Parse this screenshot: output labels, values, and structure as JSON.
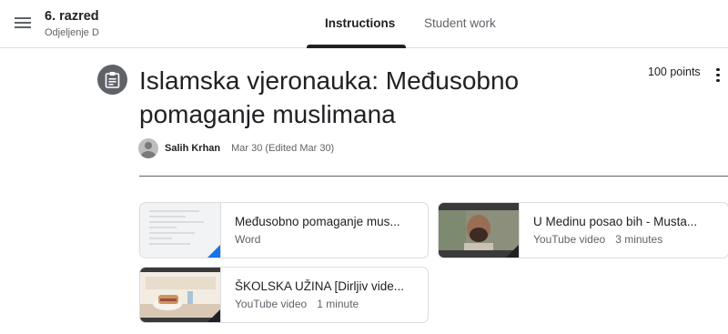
{
  "header": {
    "class_name": "6. razred",
    "class_section": "Odjeljenje D",
    "tabs": [
      {
        "label": "Instructions",
        "active": true
      },
      {
        "label": "Student work",
        "active": false
      }
    ]
  },
  "assignment": {
    "title": "Islamska vjeronauka: Međusobno pomaganje muslimana",
    "points": "100 points",
    "author": "Salih Krhan",
    "date": "Mar 30 (Edited Mar 30)",
    "icon": "assignment-icon"
  },
  "attachments": [
    {
      "title": "Međusobno pomaganje mus...",
      "type": "Word",
      "duration": "",
      "corner_color": "#1a73e8"
    },
    {
      "title": "U Medinu posao bih - Musta...",
      "type": "YouTube video",
      "duration": "3 minutes",
      "corner_color": "#202124"
    },
    {
      "title": "ŠKOLSKA UŽINA [Dirljiv vide...",
      "type": "YouTube video",
      "duration": "1 minute",
      "corner_color": "#202124"
    }
  ],
  "colors": {
    "word_corner": "#1a73e8",
    "video_corner": "#202124",
    "icon_bg": "#5f6368"
  }
}
